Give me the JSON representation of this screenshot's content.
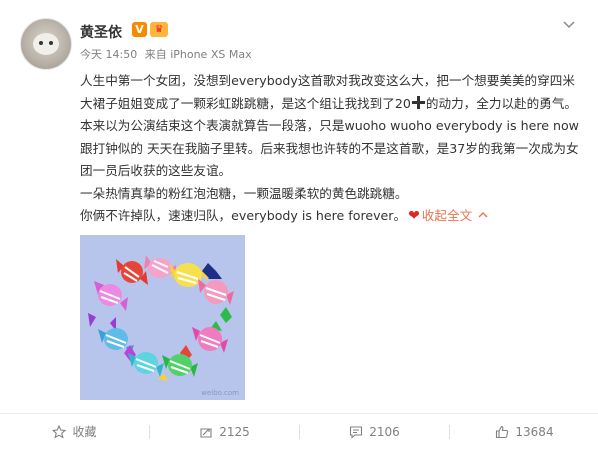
{
  "post": {
    "author": "黄圣依",
    "verified_badge": "V",
    "member_badge": "♛",
    "time": "今天 14:50",
    "source": "来自 iPhone XS Max",
    "text": {
      "line1a": "人生中第一个女团，没想到everybody这首歌对我改变这么大，把一个想要美美的穿四米大裙子姐姐变成了一颗彩虹跳跳糖，是这个组让我找到了20",
      "line1b": "的动力，全力以赴的勇气。本来以为公演结束这个表演就算告一段落，只是wuoho wuoho everybody is here now跟打钟似的 天天在我脑子里转。后来我想也许转的不是这首歌，是37岁的我第一次成为女团一员后收获的这些友谊。",
      "line2": "一朵热情真挚的粉红泡泡糖，一颗温暖柔软的黄色跳跳糖。",
      "line3": "你俩不许掉队，速速归队，everybody is here forever。",
      "collapse": "收起全文"
    },
    "image_watermark": "weibo.com"
  },
  "actions": {
    "favorite": "收藏",
    "repost": "2125",
    "comment": "2106",
    "like": "13684"
  },
  "colors": {
    "accent": "#eb7350",
    "heart": "#e0271f",
    "photo_bg": "#b7c5ec"
  },
  "icons": [
    "chevron-down-icon",
    "star-icon",
    "repost-icon",
    "comment-icon",
    "like-icon",
    "heart-emoji-icon",
    "plus-emoji-icon"
  ]
}
